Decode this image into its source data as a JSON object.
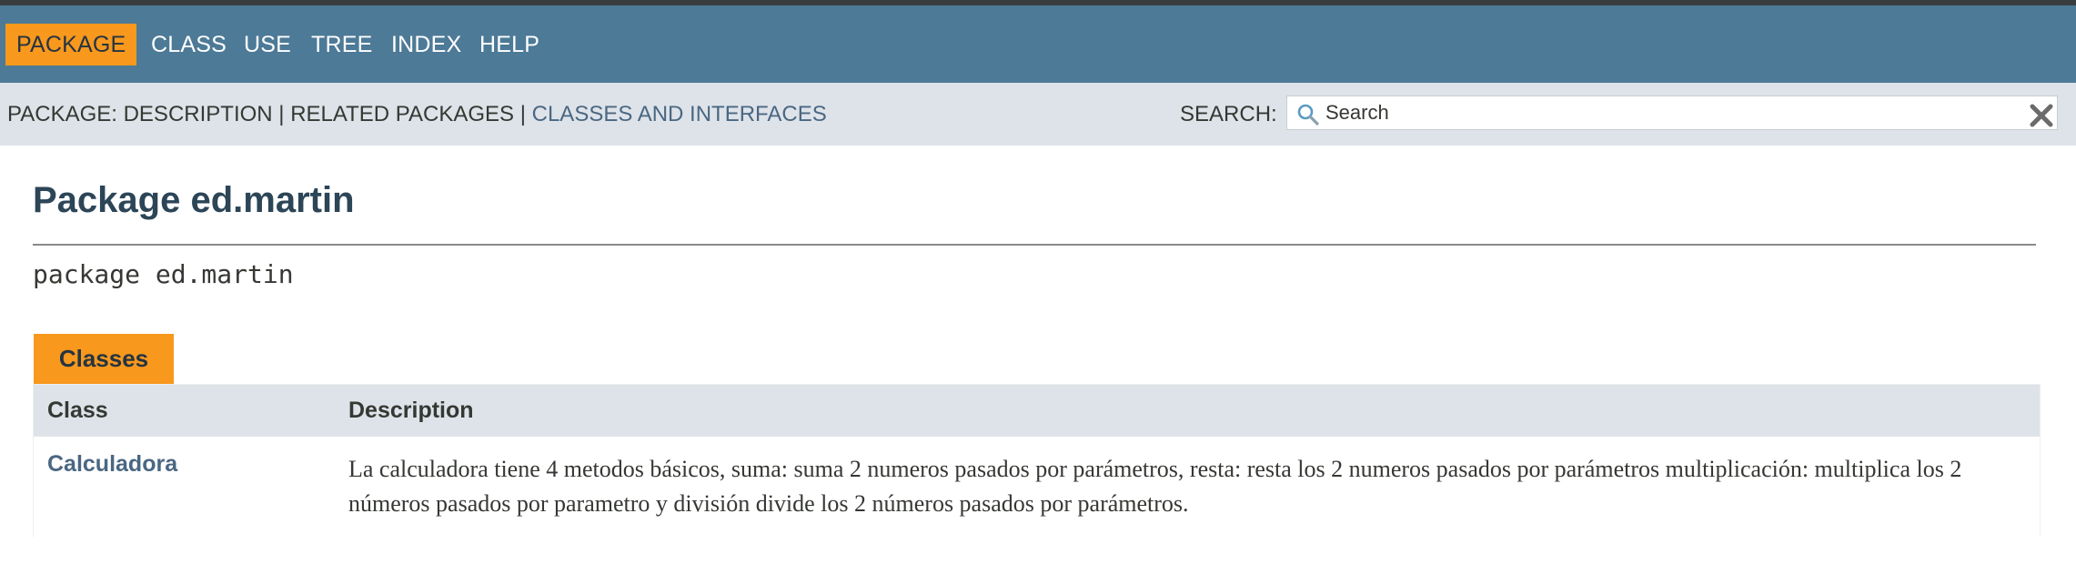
{
  "topnav": {
    "items": [
      "PACKAGE",
      "CLASS",
      "USE",
      "TREE",
      "INDEX",
      "HELP"
    ],
    "active": "PACKAGE"
  },
  "subnav": {
    "prefix": "PACKAGE: ",
    "description": "DESCRIPTION",
    "separator": " | ",
    "related": "RELATED PACKAGES",
    "classes_link": "CLASSES AND INTERFACES"
  },
  "search": {
    "label": "SEARCH:",
    "placeholder": "Search",
    "icon": "search-icon",
    "reset_icon": "close-icon"
  },
  "page": {
    "title": "Package ed.martin",
    "signature": "package ed.martin"
  },
  "classes_summary": {
    "tab_label": "Classes",
    "headers": {
      "class": "Class",
      "description": "Description"
    },
    "rows": [
      {
        "class": "Calculadora",
        "description": "La calculadora tiene 4 metodos básicos, suma: suma 2 numeros pasados por parámetros, resta: resta los 2 numeros pasados por parámetros multiplicación: multiplica los 2 números pasados por parametro y división divide los 2 números pasados por parámetros."
      }
    ]
  },
  "colors": {
    "nav_bg": "#4d7a97",
    "accent": "#f8981d",
    "subnav_bg": "#dee3e9",
    "link": "#4a6782",
    "title": "#2c4557"
  }
}
